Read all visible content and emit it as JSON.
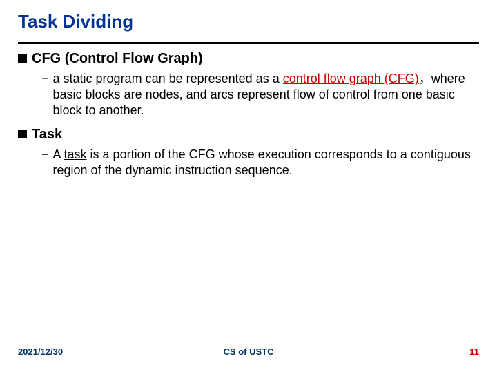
{
  "title": "Task Dividing",
  "sections": [
    {
      "heading": "CFG (Control Flow Graph)",
      "sub_prefix": "a static program can be represented as a ",
      "sub_highlight": "control flow graph (CFG)",
      "sub_comma": "，",
      "sub_suffix": "where basic blocks are nodes, and arcs represent flow of control from one basic block to another."
    },
    {
      "heading": "Task",
      "sub_prefix": "A ",
      "sub_highlight": "task",
      "sub_suffix": " is a portion of the CFG whose execution corresponds to a contiguous region of the dynamic instruction sequence."
    }
  ],
  "footer": {
    "date": "2021/12/30",
    "center": "CS of USTC",
    "page": "11"
  }
}
